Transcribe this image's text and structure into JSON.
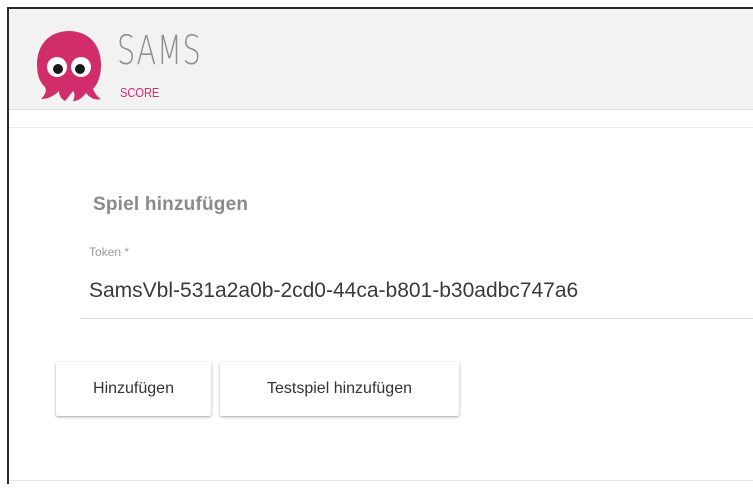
{
  "brand": {
    "wordmark": "SAMS",
    "subtitle": "SCORE",
    "accent_color": "#d12d6b",
    "logo_icon": "octopus-mascot-icon"
  },
  "card": {
    "title": "Spiel hinzufügen"
  },
  "token_field": {
    "label": "Token *",
    "value": "SamsVbl-531a2a0b-2cd0-44ca-b801-b30adbc747a6"
  },
  "actions": {
    "add_label": "Hinzufügen",
    "test_label": "Testspiel hinzufügen"
  }
}
